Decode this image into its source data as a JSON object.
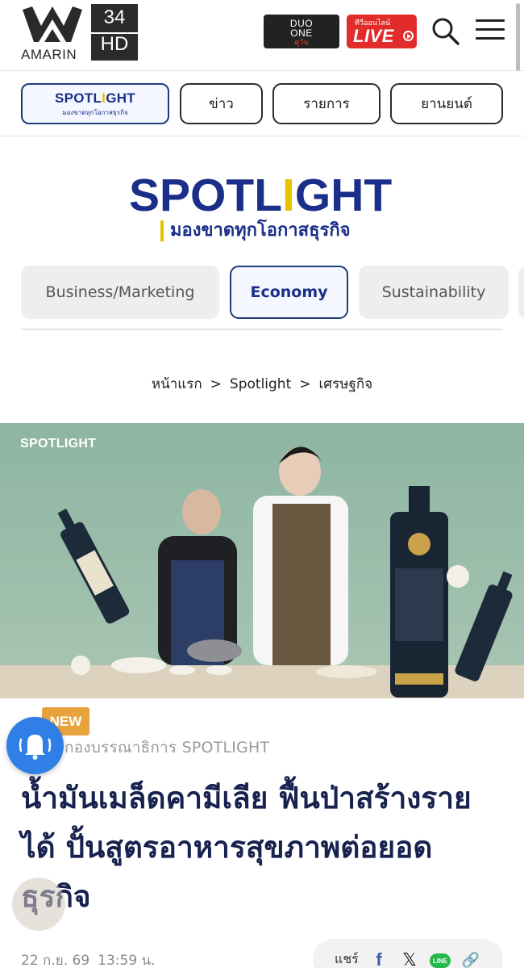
{
  "header": {
    "amarin_wordmark": "AMARIN",
    "channel_number": "34",
    "channel_suffix": "HD",
    "duo_line1": "DUO",
    "duo_line2": "ONE",
    "duo_line3": "ดูวัน",
    "live_small": "ทีวีออนไลน์",
    "live_label": "LIVE"
  },
  "nav": {
    "spotlight_wordmark_a": "SPOTL",
    "spotlight_wordmark_b": "I",
    "spotlight_wordmark_c": "GHT",
    "spotlight_tagline": "มองขาดทุกโอกาสธุรกิจ",
    "items": [
      "ข่าว",
      "รายการ",
      "ยานยนต์"
    ]
  },
  "brand": {
    "word_a": "SPOTL",
    "word_b": "I",
    "word_c": "GHT",
    "tagline": "มองขาดทุกโอกาสธุรกิจ"
  },
  "categories": {
    "items": [
      "Business/Marketing",
      "Economy",
      "Sustainability"
    ],
    "active": "Economy"
  },
  "breadcrumb": {
    "home": "หน้าแรก",
    "section": "Spotlight",
    "current": "เศรษฐกิจ",
    "separator": ">"
  },
  "hero": {
    "overlay_label": "SPOTLIGHT"
  },
  "article": {
    "badge": "NEW",
    "author": "กองบรรณาธิการ SPOTLIGHT",
    "headline_lines": [
      "น้ำมันเมล็ดคามีเลีย ฟื้นป่าสร้างราย",
      "ได้ ปั้นสูตรอาหารสุขภาพต่อยอด",
      "ธุรกิจ"
    ],
    "date": "22 ก.ย. 69",
    "time": "13:59 น."
  },
  "share": {
    "label": "แชร์",
    "line_text": "LINE",
    "icons": [
      "facebook-icon",
      "x-icon",
      "line-icon",
      "link-icon"
    ]
  },
  "colors": {
    "brand_blue": "#1b2f8a",
    "brand_yellow": "#e6c300",
    "live_red": "#e22b2b",
    "badge_orange": "#e8a33d",
    "bell_blue": "#2f7fe6"
  }
}
